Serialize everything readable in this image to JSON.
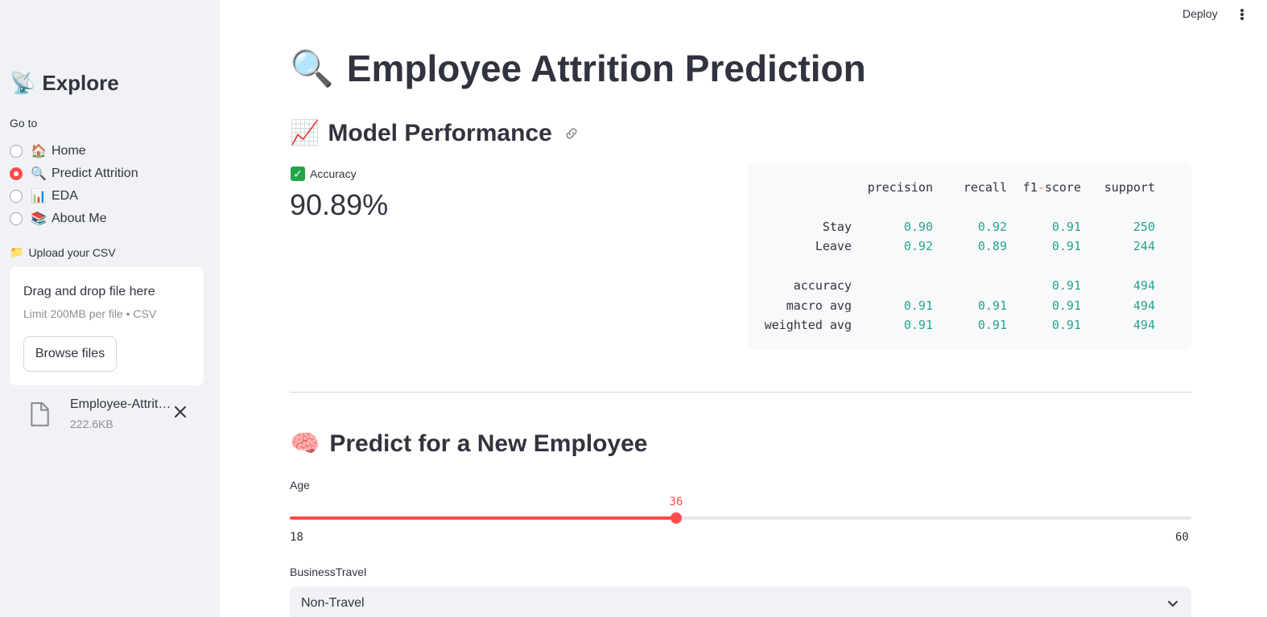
{
  "header": {
    "deploy_label": "Deploy"
  },
  "sidebar": {
    "title_emoji": "📡",
    "title": "Explore",
    "goto_label": "Go to",
    "nav": [
      {
        "emoji": "🏠",
        "label": "Home",
        "checked": false
      },
      {
        "emoji": "🔍",
        "label": "Predict Attrition",
        "checked": true
      },
      {
        "emoji": "📊",
        "label": "EDA",
        "checked": false
      },
      {
        "emoji": "📚",
        "label": "About Me",
        "checked": false
      }
    ],
    "upload_emoji": "📁",
    "upload_label": "Upload your CSV",
    "dropzone_title": "Drag and drop file here",
    "dropzone_limit": "Limit 200MB per file • CSV",
    "browse_label": "Browse files",
    "file": {
      "name": "Employee-Attrition.csv",
      "size": "222.6KB"
    }
  },
  "main": {
    "title_emoji": "🔍",
    "title": "Employee Attrition Prediction",
    "perf_emoji": "📈",
    "perf_title": "Model Performance",
    "metric_check": "✓",
    "metric_label": "Accuracy",
    "metric_value": "90.89%",
    "report": {
      "headers": [
        "precision",
        "recall",
        "f1-score",
        "support"
      ],
      "rows": [
        {
          "label": "Stay",
          "values": [
            "0.90",
            "0.92",
            "0.91",
            "250"
          ]
        },
        {
          "label": "Leave",
          "values": [
            "0.92",
            "0.89",
            "0.91",
            "244"
          ]
        },
        {
          "label": "accuracy",
          "values": [
            "",
            "",
            "0.91",
            "494"
          ]
        },
        {
          "label": "macro avg",
          "values": [
            "0.91",
            "0.91",
            "0.91",
            "494"
          ]
        },
        {
          "label": "weighted avg",
          "values": [
            "0.91",
            "0.91",
            "0.91",
            "494"
          ]
        }
      ]
    },
    "predict_emoji": "🧠",
    "predict_title": "Predict for a New Employee",
    "age": {
      "label": "Age",
      "min": 18,
      "max": 60,
      "value": 36
    },
    "business_travel": {
      "label": "BusinessTravel",
      "value": "Non-Travel"
    }
  },
  "colors": {
    "accent": "#ff4b4b",
    "sidebar_bg": "#f0f2f6",
    "code_number": "#29a38f"
  }
}
